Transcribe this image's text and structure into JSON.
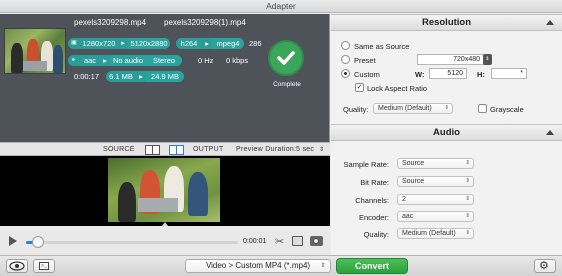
{
  "window": {
    "title": "Adapter"
  },
  "file": {
    "source_name": "pexels3209298.mp4",
    "output_name": "pexels3209298(1).mp4",
    "resolution_src": "1280x720",
    "resolution_out": "5120x2880",
    "vcodec_src": "h264",
    "vcodec_out": "mpeg4",
    "vbitrate": "286",
    "acodec_src": "aac",
    "audio_out": "No audio",
    "audio_channels": "Stereo",
    "hz": "0 Hz",
    "kbps": "0 kbps",
    "duration": "0:00:17",
    "size_src": "6.1 MB",
    "size_out": "24.9 MB",
    "status": "Complete"
  },
  "preview": {
    "source_label": "SOURCE",
    "output_label": "OUTPUT",
    "duration_label": "Preview Duration:",
    "duration_value": "5 sec"
  },
  "playback": {
    "time": "0:00:01",
    "progress": 0.055
  },
  "resolution_panel": {
    "title": "Resolution",
    "same_as_source": "Same as Source",
    "preset": "Preset",
    "preset_value": "720x480",
    "custom": "Custom",
    "selected": "Custom",
    "w_label": "W:",
    "w_value": "5120",
    "h_label": "H:",
    "h_value": "*",
    "lock_aspect": "Lock Aspect Ratio",
    "lock_checked": true,
    "quality_label": "Quality:",
    "quality_value": "Medium (Default)",
    "grayscale": "Grayscale"
  },
  "audio_panel": {
    "title": "Audio",
    "rows": [
      {
        "label": "Sample Rate:",
        "value": "Source"
      },
      {
        "label": "Bit Rate:",
        "value": "Source"
      },
      {
        "label": "Channels:",
        "value": "2"
      },
      {
        "label": "Encoder:",
        "value": "aac"
      },
      {
        "label": "Quality:",
        "value": "Medium (Default)"
      }
    ]
  },
  "toolbar": {
    "format": "Video > Custom MP4 (*.mp4)",
    "convert_label": "Convert"
  },
  "colors": {
    "accent_teal": "#2a9d99",
    "convert_green": "#3aae48",
    "complete_green": "#3ba559",
    "card_bg": "#4d5358"
  }
}
